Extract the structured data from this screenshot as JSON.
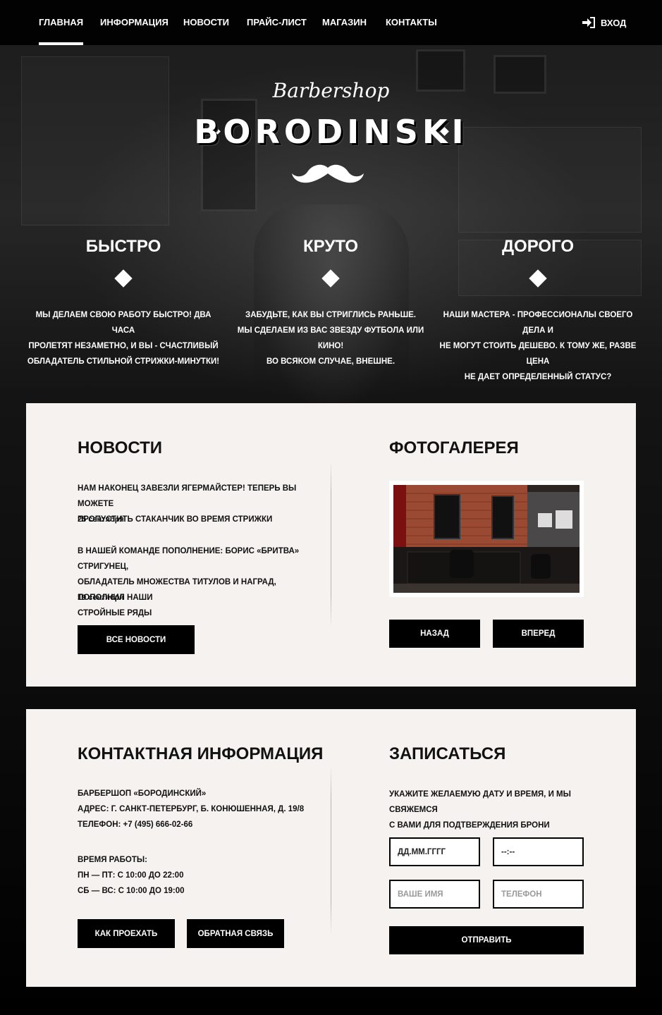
{
  "nav": {
    "items": [
      {
        "label": "ГЛАВНАЯ",
        "active": true
      },
      {
        "label": "ИНФОРМАЦИЯ"
      },
      {
        "label": "НОВОСТИ"
      },
      {
        "label": "ПРАЙС-ЛИСТ"
      },
      {
        "label": "МАГАЗИН"
      },
      {
        "label": "КОНТАКТЫ"
      }
    ],
    "login_label": "ВХОД",
    "login_icon": "sign-in-icon"
  },
  "logo": {
    "script": "Barbershop",
    "main": "BORODINSKI",
    "icon": "mustache-icon"
  },
  "features": [
    {
      "title": "БЫСТРО",
      "lines": [
        "МЫ ДЕЛАЕМ СВОЮ РАБОТУ БЫСТРО! ДВА ЧАСА",
        "ПРОЛЕТЯТ НЕЗАМЕТНО, И ВЫ - СЧАСТЛИВЫЙ",
        "ОБЛАДАТЕЛЬ СТИЛЬНОЙ СТРИЖКИ-МИНУТКИ!"
      ]
    },
    {
      "title": "КРУТО",
      "lines": [
        "ЗАБУДЬТЕ, КАК ВЫ СТРИГЛИСЬ РАНЬШЕ.",
        "МЫ СДЕЛАЕМ ИЗ ВАС ЗВЕЗДУ ФУТБОЛА ИЛИ КИНО!",
        "ВО ВСЯКОМ СЛУЧАЕ, ВНЕШНЕ."
      ]
    },
    {
      "title": "ДОРОГО",
      "lines": [
        "НАШИ МАСТЕРА - ПРОФЕССИОНАЛЫ СВОЕГО ДЕЛА И",
        "НЕ МОГУТ СТОИТЬ ДЕШЕВО. К ТОМУ ЖЕ, РАЗВЕ ЦЕНА",
        "НЕ ДАЕТ ОПРЕДЕЛЕННЫЙ СТАТУС?"
      ]
    }
  ],
  "news": {
    "title": "НОВОСТИ",
    "items": [
      {
        "lines": [
          "НАМ НАКОНЕЦ ЗАВЕЗЛИ ЯГЕРМАЙСТЕР! ТЕПЕРЬ ВЫ МОЖЕТЕ",
          "ПРОПУСТИТЬ СТАКАНЧИК ВО ВРЕМЯ СТРИЖКИ"
        ],
        "date": "25 сентября"
      },
      {
        "lines": [
          "В НАШЕЙ КОМАНДЕ ПОПОЛНЕНИЕ: БОРИС «БРИТВА» СТРИГУНЕЦ,",
          "ОБЛАДАТЕЛЬ МНОЖЕСТВА ТИТУЛОВ И НАГРАД, ПОПОЛНИЛ НАШИ",
          "СТРОЙНЫЕ РЯДЫ"
        ],
        "date": "19 сентября"
      }
    ],
    "all_button": "ВСЕ НОВОСТИ"
  },
  "gallery": {
    "title": "ФОТОГАЛЕРЕЯ",
    "prev_button": "НАЗАД",
    "next_button": "ВПЕРЕД"
  },
  "contacts": {
    "title": "КОНТАКТНАЯ ИНФОРМАЦИЯ",
    "lines": [
      "БАРБЕРШОП «БОРОДИНСКИЙ»",
      "АДРЕС: Г. САНКТ-ПЕТЕРБУРГ, Б. КОНЮШЕННАЯ, Д. 19/8",
      "ТЕЛЕФОН: +7 (495) 666-02-66"
    ],
    "hours_title": "ВРЕМЯ РАБОТЫ:",
    "hours": [
      "ПН — ПТ: С 10:00 ДО 22:00",
      "СБ — ВС: С 10:00 ДО 19:00"
    ],
    "route_button": "КАК ПРОЕХАТЬ",
    "feedback_button": "ОБРАТНАЯ СВЯЗЬ"
  },
  "booking": {
    "title": "ЗАПИСАТЬСЯ",
    "lines": [
      "УКАЖИТЕ ЖЕЛАЕМУЮ ДАТУ И ВРЕМЯ, И МЫ СВЯЖЕМСЯ",
      "С ВАМИ ДЛЯ ПОДТВЕРЖДЕНИЯ БРОНИ"
    ],
    "date_value": "ДД.ММ.ГГГГ",
    "time_value": "--:--",
    "name_placeholder": "ВАШЕ ИМЯ",
    "phone_placeholder": "ТЕЛЕФОН",
    "submit_button": "ОТПРАВИТЬ"
  }
}
